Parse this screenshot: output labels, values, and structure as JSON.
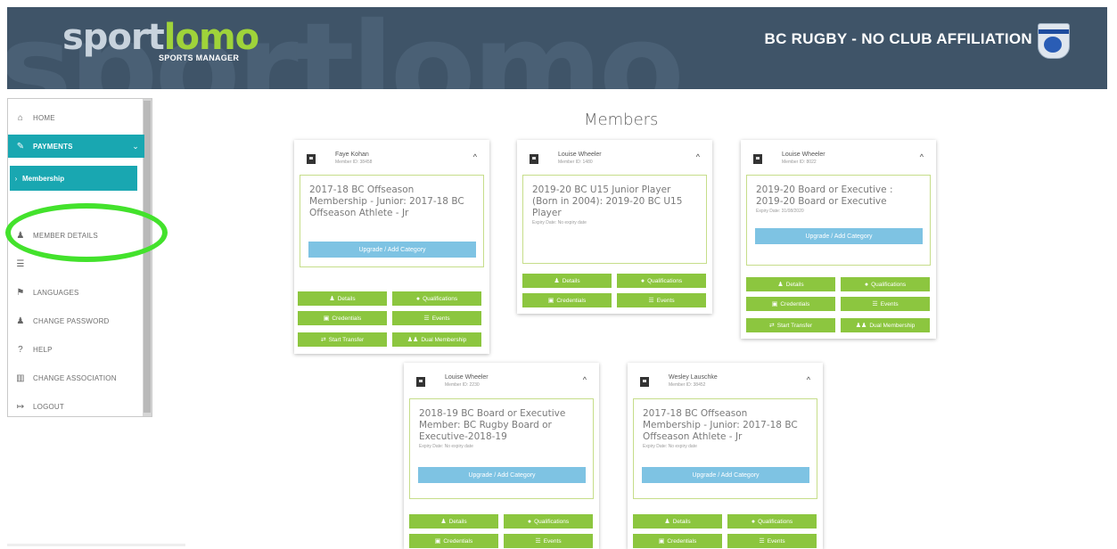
{
  "header": {
    "bg_word": "sportlomo",
    "logo_part1": "sport",
    "logo_part2": "lomo",
    "logo_sub": "SPORTS MANAGER",
    "org_title": "BC RUGBY - NO CLUB AFFILIATION",
    "org_badge_icon": "bc-rugby-crest-icon"
  },
  "sidebar": {
    "items": [
      {
        "label": "HOME",
        "icon": "home-icon",
        "glyph": "⌂"
      },
      {
        "label": "PAYMENTS",
        "icon": "edit-icon",
        "glyph": "✎"
      },
      {
        "label": "MEMBER DETAILS",
        "icon": "user-icon",
        "glyph": "♟"
      },
      {
        "label": "",
        "icon": "list-icon",
        "glyph": "☰"
      },
      {
        "label": "LANGUAGES",
        "icon": "flag-icon",
        "glyph": "⚑"
      },
      {
        "label": "CHANGE PASSWORD",
        "icon": "user-icon",
        "glyph": "♟"
      },
      {
        "label": "HELP",
        "icon": "question-icon",
        "glyph": "?"
      },
      {
        "label": "CHANGE ASSOCIATION",
        "icon": "building-icon",
        "glyph": "▥"
      },
      {
        "label": "LOGOUT",
        "icon": "logout-icon",
        "glyph": "↦"
      }
    ],
    "payments_chevron": "⌄",
    "sub_item": {
      "label": "Membership",
      "glyph": "›"
    },
    "accent_color": "#19a7b1",
    "callout_color": "#43e22c"
  },
  "main": {
    "title": "Members",
    "upgrade_label": "Upgrade / Add Category",
    "buttons": {
      "details": "Details",
      "qualifications": "Qualifications",
      "credentials": "Credentials",
      "events": "Events",
      "start_transfer": "Start Transfer",
      "dual_membership": "Dual Membership"
    },
    "button_glyphs": {
      "details": "♟",
      "qualifications": "●",
      "credentials": "▣",
      "events": "☰",
      "start_transfer": "⇄",
      "dual_membership": "♟♟"
    },
    "button_color": "#8cc63f",
    "upgrade_color": "#7ec3e3",
    "cards": [
      {
        "name": "Faye Kohan",
        "member_id": "Member ID: 38458",
        "membership": "2017-18 BC Offseason Membership - Junior: 2017-18 BC Offseason Athlete - Jr",
        "expiry": ""
      },
      {
        "name": "Louise Wheeler",
        "member_id": "Member ID: 1480",
        "membership": "2019-20 BC U15 Junior Player (Born in 2004): 2019-20 BC U15 Player",
        "expiry": "Expiry Date: No expiry date"
      },
      {
        "name": "Louise Wheeler",
        "member_id": "Member ID: 8022",
        "membership": "2019-20 Board or Executive : 2019-20 Board or Executive",
        "expiry": "Expiry Date: 31/08/2020"
      },
      {
        "name": "Louise Wheeler",
        "member_id": "Member ID: 2230",
        "membership": "2018-19 BC Board or Executive Member: BC Rugby Board or Executive-2018-19",
        "expiry": "Expiry Date: No expiry date"
      },
      {
        "name": "Wesley Lauschke",
        "member_id": "Member ID: 38452",
        "membership": "2017-18 BC Offseason Membership - Junior: 2017-18 BC Offseason Athlete - Jr",
        "expiry": "Expiry Date: No expiry date"
      }
    ]
  }
}
